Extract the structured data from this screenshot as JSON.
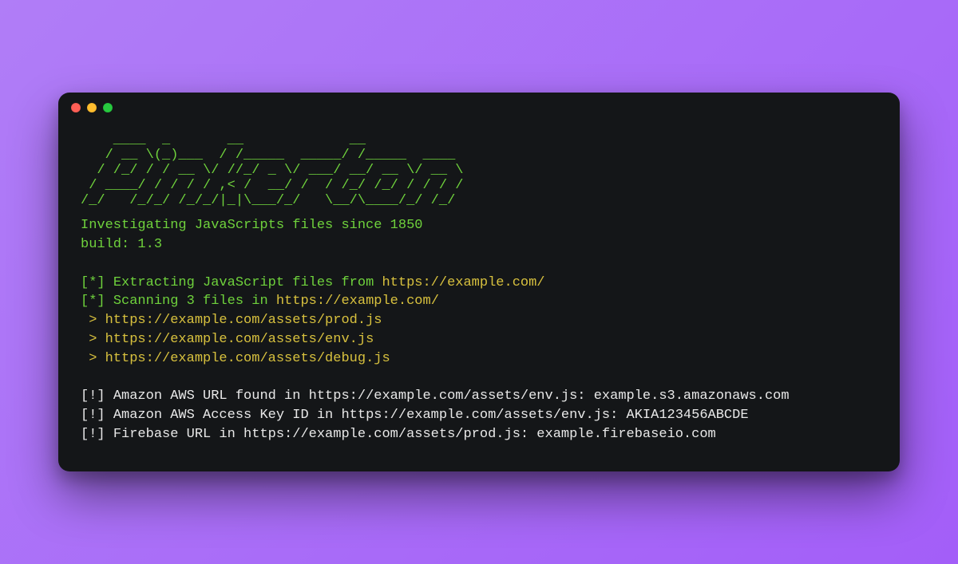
{
  "colors": {
    "background": "#a35ef8",
    "terminal_bg": "#141618",
    "green": "#6fd23c",
    "yellow": "#d8c13e",
    "white": "#e8e8e8",
    "dot_red": "#ff5f56",
    "dot_yellow": "#ffbd2e",
    "dot_green": "#27c93f"
  },
  "ascii_art": "    ____  _       __             __             \n   / __ \\(_)___  / /_____  _____/ /_____  ____  \n  / /_/ / / __ \\/ //_/ _ \\/ ___/ __/ __ \\/ __ \\ \n / ____/ / / / / ,< /  __/ /  / /_/ /_/ / / / / \n/_/   /_/_/ /_/_/|_|\\___/_/   \\__/\\____/_/ /_/  ",
  "tagline": "Investigating JavaScripts files since 1850",
  "build_label": "build: 1.3",
  "status": {
    "marker": "[*]",
    "extract_prefix": "Extracting JavaScript files from ",
    "extract_url": "https://example.com/",
    "scan_prefix": "Scanning 3 files in ",
    "scan_url": "https://example.com/"
  },
  "files": {
    "prefix": " > ",
    "items": [
      "https://example.com/assets/prod.js",
      "https://example.com/assets/env.js",
      "https://example.com/assets/debug.js"
    ]
  },
  "findings": {
    "marker": "[!]",
    "items": [
      "Amazon AWS URL found in https://example.com/assets/env.js: example.s3.amazonaws.com",
      "Amazon AWS Access Key ID in https://example.com/assets/env.js: AKIA123456ABCDE",
      "Firebase URL in https://example.com/assets/prod.js: example.firebaseio.com"
    ]
  }
}
